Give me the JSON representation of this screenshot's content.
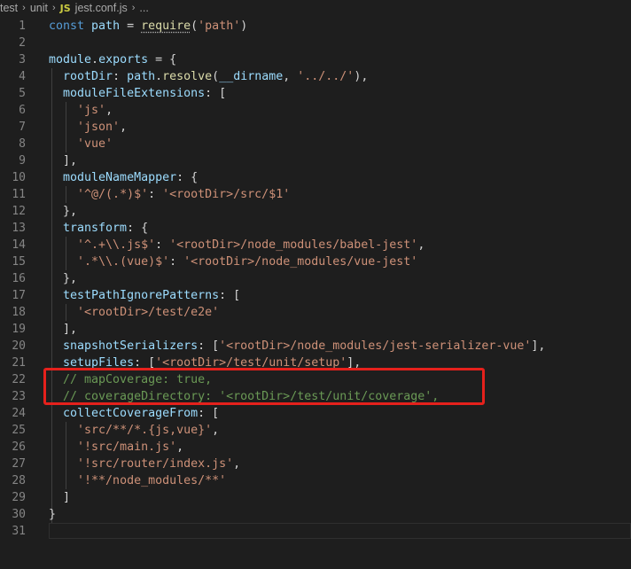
{
  "breadcrumb": {
    "items": [
      "test",
      "unit"
    ],
    "file_badge": "JS",
    "file_name": "jest.conf.js",
    "ellipsis": "..."
  },
  "editor": {
    "language": "javascript",
    "highlight_lines": [
      22,
      23
    ],
    "colors": {
      "background": "#1e1e1e",
      "keyword": "#569cd6",
      "variable": "#9cdcfe",
      "function": "#dcdcaa",
      "string": "#ce9178",
      "comment": "#6a9955",
      "highlight_box": "#e5211c"
    },
    "lines": [
      {
        "n": "1",
        "tokens": [
          [
            "kw",
            "const"
          ],
          [
            "pun",
            " "
          ],
          [
            "var",
            "path"
          ],
          [
            "pun",
            " = "
          ],
          [
            "fn",
            "require"
          ],
          [
            "pun",
            "("
          ],
          [
            "str",
            "'path'"
          ],
          [
            "pun",
            ")"
          ]
        ]
      },
      {
        "n": "2",
        "tokens": []
      },
      {
        "n": "3",
        "tokens": [
          [
            "var",
            "module"
          ],
          [
            "pun",
            "."
          ],
          [
            "var",
            "exports"
          ],
          [
            "pun",
            " = {"
          ]
        ]
      },
      {
        "n": "4",
        "tokens": [
          [
            "pun",
            "  "
          ],
          [
            "var",
            "rootDir"
          ],
          [
            "pun",
            ": "
          ],
          [
            "var",
            "path"
          ],
          [
            "pun",
            "."
          ],
          [
            "fn",
            "resolve"
          ],
          [
            "pun",
            "("
          ],
          [
            "var",
            "__dirname"
          ],
          [
            "pun",
            ", "
          ],
          [
            "str",
            "'../../'"
          ],
          [
            "pun",
            "),"
          ]
        ]
      },
      {
        "n": "5",
        "tokens": [
          [
            "pun",
            "  "
          ],
          [
            "var",
            "moduleFileExtensions"
          ],
          [
            "pun",
            ": ["
          ]
        ]
      },
      {
        "n": "6",
        "tokens": [
          [
            "pun",
            "    "
          ],
          [
            "str",
            "'js'"
          ],
          [
            "pun",
            ","
          ]
        ]
      },
      {
        "n": "7",
        "tokens": [
          [
            "pun",
            "    "
          ],
          [
            "str",
            "'json'"
          ],
          [
            "pun",
            ","
          ]
        ]
      },
      {
        "n": "8",
        "tokens": [
          [
            "pun",
            "    "
          ],
          [
            "str",
            "'vue'"
          ]
        ]
      },
      {
        "n": "9",
        "tokens": [
          [
            "pun",
            "  ],"
          ]
        ]
      },
      {
        "n": "10",
        "tokens": [
          [
            "pun",
            "  "
          ],
          [
            "var",
            "moduleNameMapper"
          ],
          [
            "pun",
            ": {"
          ]
        ]
      },
      {
        "n": "11",
        "tokens": [
          [
            "pun",
            "    "
          ],
          [
            "str",
            "'^@/(.*)$'"
          ],
          [
            "pun",
            ": "
          ],
          [
            "str",
            "'<rootDir>/src/$1'"
          ]
        ]
      },
      {
        "n": "12",
        "tokens": [
          [
            "pun",
            "  },"
          ]
        ]
      },
      {
        "n": "13",
        "tokens": [
          [
            "pun",
            "  "
          ],
          [
            "var",
            "transform"
          ],
          [
            "pun",
            ": {"
          ]
        ]
      },
      {
        "n": "14",
        "tokens": [
          [
            "pun",
            "    "
          ],
          [
            "str",
            "'^.+\\\\.js$'"
          ],
          [
            "pun",
            ": "
          ],
          [
            "str",
            "'<rootDir>/node_modules/babel-jest'"
          ],
          [
            "pun",
            ","
          ]
        ]
      },
      {
        "n": "15",
        "tokens": [
          [
            "pun",
            "    "
          ],
          [
            "str",
            "'.*\\\\.(vue)$'"
          ],
          [
            "pun",
            ": "
          ],
          [
            "str",
            "'<rootDir>/node_modules/vue-jest'"
          ]
        ]
      },
      {
        "n": "16",
        "tokens": [
          [
            "pun",
            "  },"
          ]
        ]
      },
      {
        "n": "17",
        "tokens": [
          [
            "pun",
            "  "
          ],
          [
            "var",
            "testPathIgnorePatterns"
          ],
          [
            "pun",
            ": ["
          ]
        ]
      },
      {
        "n": "18",
        "tokens": [
          [
            "pun",
            "    "
          ],
          [
            "str",
            "'<rootDir>/test/e2e'"
          ]
        ]
      },
      {
        "n": "19",
        "tokens": [
          [
            "pun",
            "  ],"
          ]
        ]
      },
      {
        "n": "20",
        "tokens": [
          [
            "pun",
            "  "
          ],
          [
            "var",
            "snapshotSerializers"
          ],
          [
            "pun",
            ": ["
          ],
          [
            "str",
            "'<rootDir>/node_modules/jest-serializer-vue'"
          ],
          [
            "pun",
            "],"
          ]
        ]
      },
      {
        "n": "21",
        "tokens": [
          [
            "pun",
            "  "
          ],
          [
            "var",
            "setupFiles"
          ],
          [
            "pun",
            ": ["
          ],
          [
            "str",
            "'<rootDir>/test/unit/setup'"
          ],
          [
            "pun",
            "],"
          ]
        ]
      },
      {
        "n": "22",
        "tokens": [
          [
            "pun",
            "  "
          ],
          [
            "cmt",
            "// mapCoverage: true,"
          ]
        ]
      },
      {
        "n": "23",
        "tokens": [
          [
            "pun",
            "  "
          ],
          [
            "cmt",
            "// coverageDirectory: '<rootDir>/test/unit/coverage',"
          ]
        ]
      },
      {
        "n": "24",
        "tokens": [
          [
            "pun",
            "  "
          ],
          [
            "var",
            "collectCoverageFrom"
          ],
          [
            "pun",
            ": ["
          ]
        ]
      },
      {
        "n": "25",
        "tokens": [
          [
            "pun",
            "    "
          ],
          [
            "str",
            "'src/**/*.{js,vue}'"
          ],
          [
            "pun",
            ","
          ]
        ]
      },
      {
        "n": "26",
        "tokens": [
          [
            "pun",
            "    "
          ],
          [
            "str",
            "'!src/main.js'"
          ],
          [
            "pun",
            ","
          ]
        ]
      },
      {
        "n": "27",
        "tokens": [
          [
            "pun",
            "    "
          ],
          [
            "str",
            "'!src/router/index.js'"
          ],
          [
            "pun",
            ","
          ]
        ]
      },
      {
        "n": "28",
        "tokens": [
          [
            "pun",
            "    "
          ],
          [
            "str",
            "'!**/node_modules/**'"
          ]
        ]
      },
      {
        "n": "29",
        "tokens": [
          [
            "pun",
            "  ]"
          ]
        ]
      },
      {
        "n": "30",
        "tokens": [
          [
            "pun",
            "}"
          ]
        ]
      },
      {
        "n": "31",
        "tokens": []
      }
    ]
  }
}
